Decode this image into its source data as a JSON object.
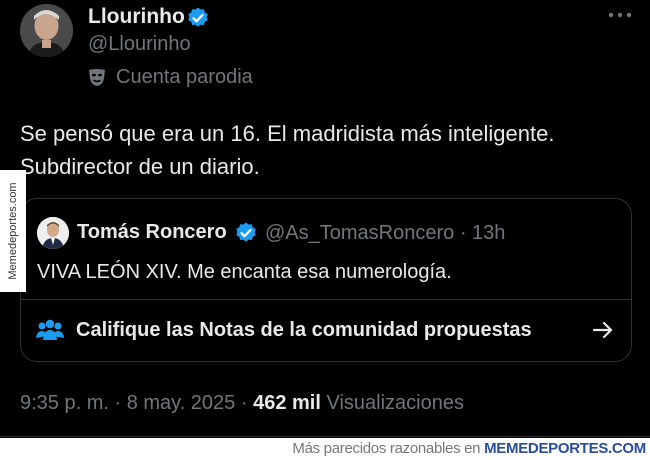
{
  "author": {
    "display_name": "Llourinho",
    "handle": "@Llourinho",
    "parody_label": "Cuenta parodia"
  },
  "tweet": {
    "line1": "Se pensó que era un 16. El madridista más inteligente.",
    "line2": "Subdirector de un diario."
  },
  "quote": {
    "display_name": "Tomás Roncero",
    "handle_time": "@As_TomasRoncero · 13h",
    "text": "VIVA LEÓN XIV. Me encanta esa numerología.",
    "notes_label": "Califique las Notas de la comunidad propuestas"
  },
  "meta": {
    "timestamp": "9:35 p. m. · 8 may. 2025 ·",
    "views_count": "462 mil",
    "views_label": "Visualizaciones"
  },
  "watermarks": {
    "side": "Memedeportes.com",
    "footer_prefix": "Más parecidos razonables en",
    "footer_brand": "MEMEDEPORTES.COM"
  },
  "colors": {
    "background": "#000000",
    "text": "#e7e9ea",
    "muted": "#71767b",
    "verified": "#1d9bf0",
    "border": "#2f3336"
  },
  "icons": [
    "verified-badge-icon",
    "more-icon",
    "parody-mask-icon",
    "community-notes-icon",
    "arrow-right-icon"
  ]
}
